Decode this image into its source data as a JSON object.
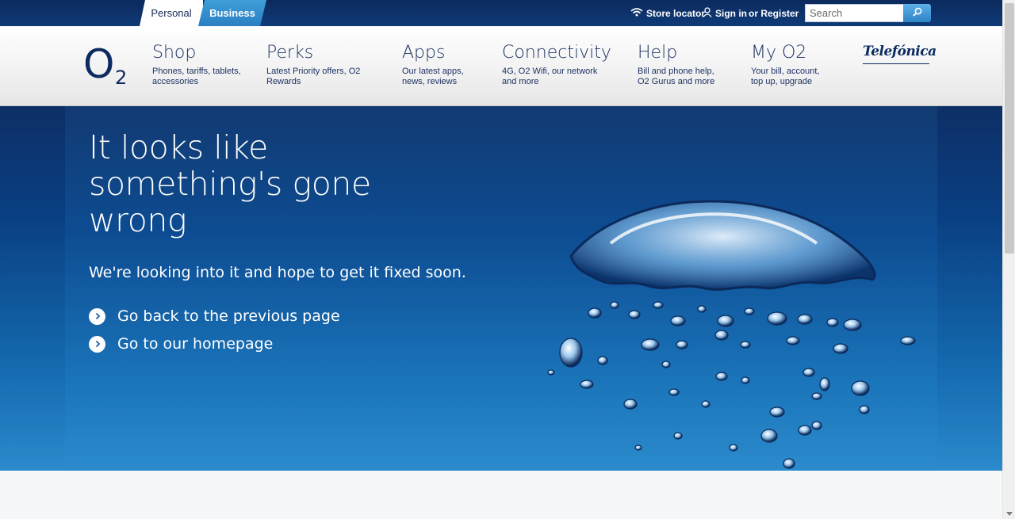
{
  "topbar": {
    "tabs": [
      {
        "label": "Personal",
        "active": true
      },
      {
        "label": "Business",
        "active": false
      }
    ],
    "store_locator": "Store locator",
    "sign_in": "Sign in",
    "or_register": "or Register",
    "search": {
      "placeholder": "Search",
      "value": ""
    },
    "icons": {
      "store": "wifi-signal-icon",
      "user": "user-icon",
      "search": "magnifier-icon"
    }
  },
  "logo": {
    "text_main": "O",
    "text_sub": "2"
  },
  "nav": [
    {
      "title": "Shop",
      "sub": "Phones, tariffs, tablets,\naccessories"
    },
    {
      "title": "Perks",
      "sub": "Latest Priority offers, O2\nRewards"
    },
    {
      "title": "Apps",
      "sub": "Our latest apps,\nnews, reviews"
    },
    {
      "title": "Connectivity",
      "sub": "4G, O2 Wifi, our network\nand more"
    },
    {
      "title": "Help",
      "sub": "Bill and phone help,\nO2 Gurus and more"
    },
    {
      "title": "My O2",
      "sub": "Your bill, account,\ntop up, upgrade"
    }
  ],
  "brand": {
    "telefonica": "Telefónica"
  },
  "hero": {
    "title": "It looks like something's gone wrong",
    "subtitle": "We're looking into it and hope to get it fixed soon.",
    "links": [
      {
        "label": "Go back to the previous page",
        "icon": "chevron-right-icon"
      },
      {
        "label": "Go to our homepage",
        "icon": "chevron-right-icon"
      }
    ]
  },
  "colors": {
    "navy": "#0b2b61",
    "hero_top": "#0d2f66",
    "hero_bottom": "#2a8acb",
    "business_tab": "#3f9ed8"
  }
}
